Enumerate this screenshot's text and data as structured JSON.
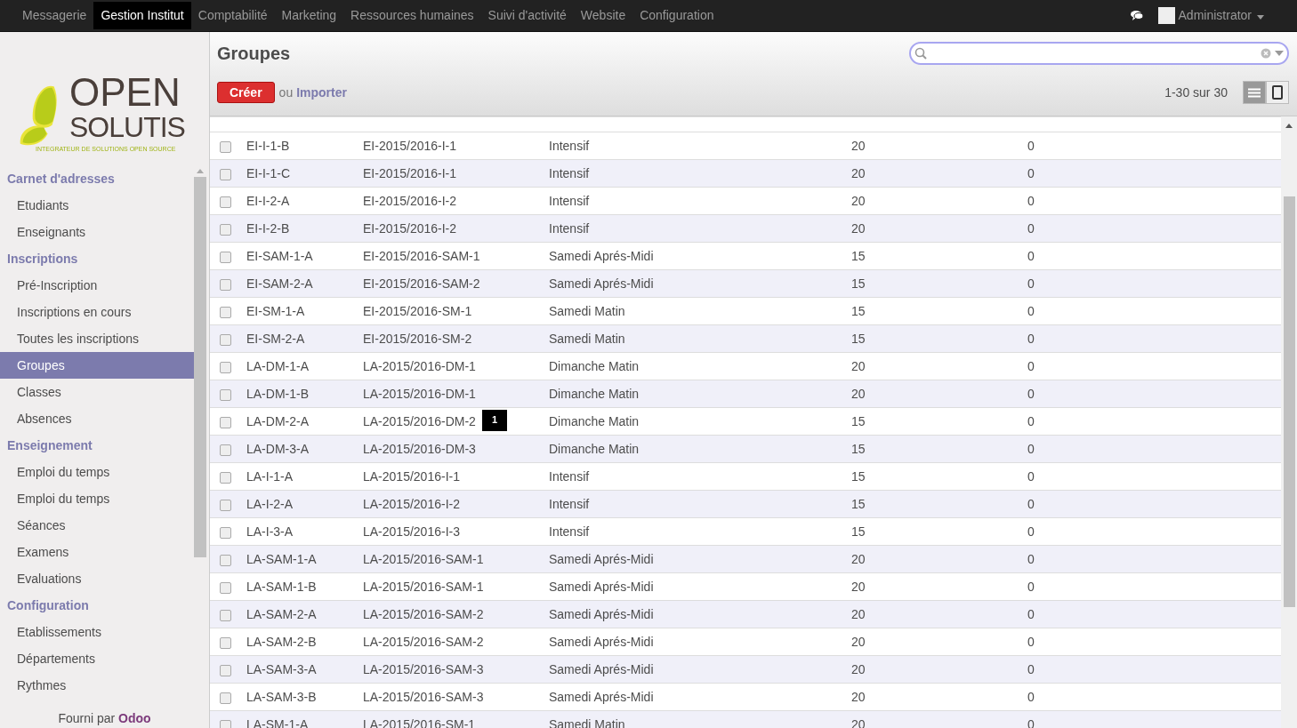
{
  "topbar": {
    "menus": [
      {
        "label": "Messagerie",
        "selected": false
      },
      {
        "label": "Gestion Institut",
        "selected": true
      },
      {
        "label": "Comptabilité",
        "selected": false
      },
      {
        "label": "Marketing",
        "selected": false
      },
      {
        "label": "Ressources humaines",
        "selected": false
      },
      {
        "label": "Suivi d'activité",
        "selected": false
      },
      {
        "label": "Website",
        "selected": false
      },
      {
        "label": "Configuration",
        "selected": false
      }
    ],
    "user": "Administrator"
  },
  "logo": {
    "line1": "OPEN",
    "line2": "SOLUTIS",
    "tagline": "INTEGRATEUR DE SOLUTIONS OPEN SOURCE"
  },
  "sidebar": {
    "sections": [
      {
        "title": "Carnet d'adresses",
        "items": [
          {
            "label": "Etudiants",
            "selected": false
          },
          {
            "label": "Enseignants",
            "selected": false
          }
        ]
      },
      {
        "title": "Inscriptions",
        "items": [
          {
            "label": "Pré-Inscription",
            "selected": false
          },
          {
            "label": "Inscriptions en cours",
            "selected": false
          },
          {
            "label": "Toutes les inscriptions",
            "selected": false
          },
          {
            "label": "Groupes",
            "selected": true
          },
          {
            "label": "Classes",
            "selected": false
          },
          {
            "label": "Absences",
            "selected": false
          }
        ]
      },
      {
        "title": "Enseignement",
        "items": [
          {
            "label": "Emploi du temps",
            "selected": false
          },
          {
            "label": "Emploi du temps",
            "selected": false
          },
          {
            "label": "Séances",
            "selected": false
          },
          {
            "label": "Examens",
            "selected": false
          },
          {
            "label": "Evaluations",
            "selected": false
          }
        ]
      },
      {
        "title": "Configuration",
        "items": [
          {
            "label": "Etablissements",
            "selected": false
          },
          {
            "label": "Départements",
            "selected": false
          },
          {
            "label": "Rythmes",
            "selected": false
          }
        ]
      }
    ],
    "footer_prefix": "Fourni par",
    "footer_link": "Odoo"
  },
  "header": {
    "title": "Groupes",
    "create": "Créer",
    "or": "ou",
    "import": "Importer",
    "pager": "1-30 sur 30",
    "views": [
      {
        "kind": "list",
        "selected": true
      },
      {
        "kind": "form",
        "selected": false
      }
    ]
  },
  "table": {
    "rows": [
      {
        "cells": [
          "EI-I-1-B",
          "EI-2015/2016-I-1",
          "Intensif",
          "20",
          "0"
        ],
        "checked": false
      },
      {
        "cells": [
          "EI-I-1-C",
          "EI-2015/2016-I-1",
          "Intensif",
          "20",
          "0"
        ],
        "checked": false
      },
      {
        "cells": [
          "EI-I-2-A",
          "EI-2015/2016-I-2",
          "Intensif",
          "20",
          "0"
        ],
        "checked": false
      },
      {
        "cells": [
          "EI-I-2-B",
          "EI-2015/2016-I-2",
          "Intensif",
          "20",
          "0"
        ],
        "checked": false
      },
      {
        "cells": [
          "EI-SAM-1-A",
          "EI-2015/2016-SAM-1",
          "Samedi Aprés-Midi",
          "15",
          "0"
        ],
        "checked": false
      },
      {
        "cells": [
          "EI-SAM-2-A",
          "EI-2015/2016-SAM-2",
          "Samedi Aprés-Midi",
          "15",
          "0"
        ],
        "checked": false
      },
      {
        "cells": [
          "EI-SM-1-A",
          "EI-2015/2016-SM-1",
          "Samedi Matin",
          "15",
          "0"
        ],
        "checked": false
      },
      {
        "cells": [
          "EI-SM-2-A",
          "EI-2015/2016-SM-2",
          "Samedi Matin",
          "15",
          "0"
        ],
        "checked": false
      },
      {
        "cells": [
          "LA-DM-1-A",
          "LA-2015/2016-DM-1",
          "Dimanche Matin",
          "20",
          "0"
        ],
        "checked": false
      },
      {
        "cells": [
          "LA-DM-1-B",
          "LA-2015/2016-DM-1",
          "Dimanche Matin",
          "20",
          "0"
        ],
        "checked": false
      },
      {
        "cells": [
          "LA-DM-2-A",
          "LA-2015/2016-DM-2",
          "Dimanche Matin",
          "15",
          "0"
        ],
        "checked": false,
        "badge": "1"
      },
      {
        "cells": [
          "LA-DM-3-A",
          "LA-2015/2016-DM-3",
          "Dimanche Matin",
          "15",
          "0"
        ],
        "checked": false
      },
      {
        "cells": [
          "LA-I-1-A",
          "LA-2015/2016-I-1",
          "Intensif",
          "15",
          "0"
        ],
        "checked": false
      },
      {
        "cells": [
          "LA-I-2-A",
          "LA-2015/2016-I-2",
          "Intensif",
          "15",
          "0"
        ],
        "checked": false
      },
      {
        "cells": [
          "LA-I-3-A",
          "LA-2015/2016-I-3",
          "Intensif",
          "15",
          "0"
        ],
        "checked": false
      },
      {
        "cells": [
          "LA-SAM-1-A",
          "LA-2015/2016-SAM-1",
          "Samedi Aprés-Midi",
          "20",
          "0"
        ],
        "checked": false
      },
      {
        "cells": [
          "LA-SAM-1-B",
          "LA-2015/2016-SAM-1",
          "Samedi Aprés-Midi",
          "20",
          "0"
        ],
        "checked": false
      },
      {
        "cells": [
          "LA-SAM-2-A",
          "LA-2015/2016-SAM-2",
          "Samedi Aprés-Midi",
          "20",
          "0"
        ],
        "checked": false
      },
      {
        "cells": [
          "LA-SAM-2-B",
          "LA-2015/2016-SAM-2",
          "Samedi Aprés-Midi",
          "20",
          "0"
        ],
        "checked": false
      },
      {
        "cells": [
          "LA-SAM-3-A",
          "LA-2015/2016-SAM-3",
          "Samedi Aprés-Midi",
          "20",
          "0"
        ],
        "checked": false
      },
      {
        "cells": [
          "LA-SAM-3-B",
          "LA-2015/2016-SAM-3",
          "Samedi Aprés-Midi",
          "20",
          "0"
        ],
        "checked": false
      },
      {
        "cells": [
          "LA-SM-1-A",
          "LA-2015/2016-SM-1",
          "Samedi Matin",
          "20",
          "0"
        ],
        "checked": false
      }
    ]
  }
}
